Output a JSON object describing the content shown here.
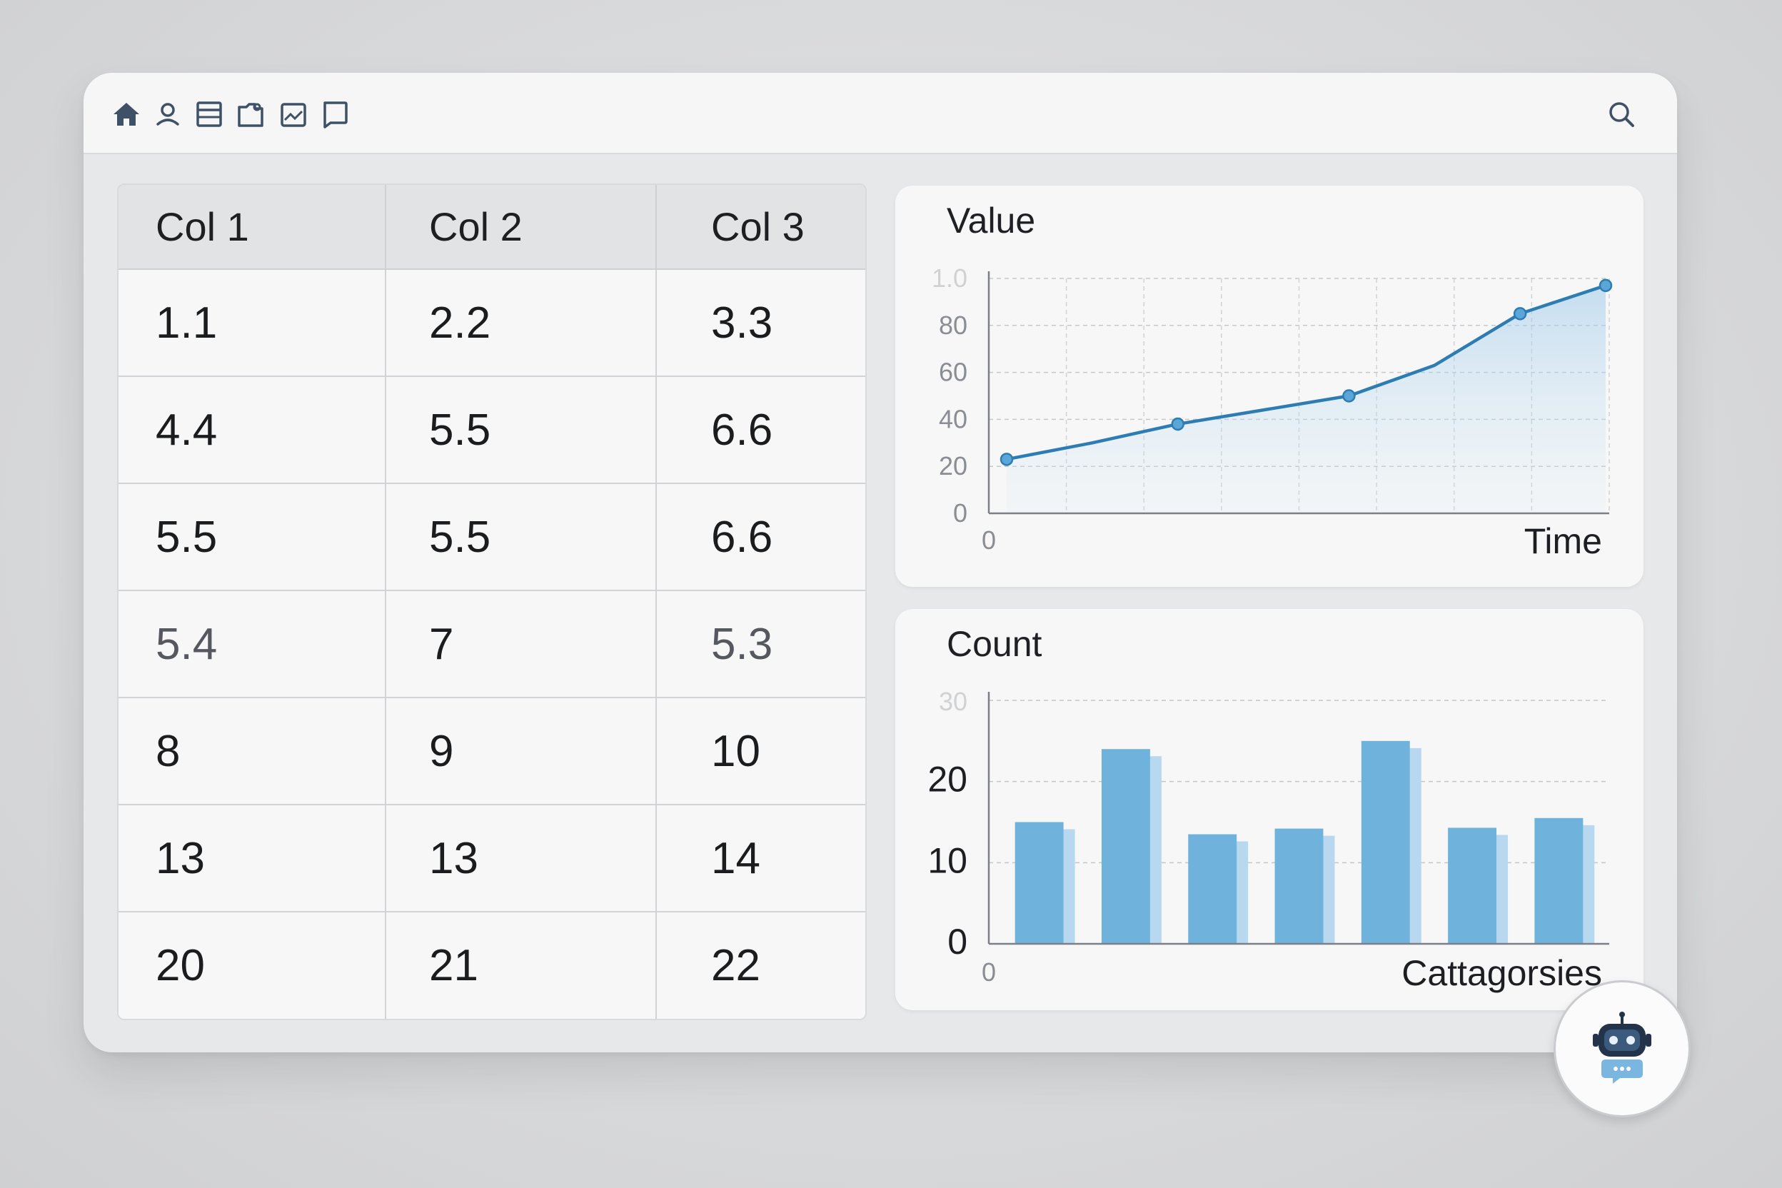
{
  "toolbar": {
    "icons": [
      "home-icon",
      "user-icon",
      "table-icon",
      "folder-icon",
      "image-icon",
      "chat-icon"
    ],
    "search_icon": "search-icon"
  },
  "table": {
    "headers": [
      "Col 1",
      "Col 2",
      "Col 3"
    ],
    "rows": [
      [
        "1.1",
        "2.2",
        "3.3"
      ],
      [
        "4.4",
        "5.5",
        "6.6"
      ],
      [
        "5.5",
        "5.5",
        "6.6"
      ],
      [
        "5.4",
        "7",
        "5.3"
      ],
      [
        "8",
        "9",
        "10"
      ],
      [
        "13",
        "13",
        "14"
      ],
      [
        "20",
        "21",
        "22"
      ]
    ]
  },
  "line_card": {
    "title": "Value",
    "xlabel": "Time",
    "x_origin_label": "0"
  },
  "bar_card": {
    "title": "Count",
    "xlabel": "Cattagorsies",
    "x_origin_label": "0"
  },
  "chart_data": [
    {
      "type": "line",
      "ylabel": "Value",
      "xlabel": "Time",
      "ylim": [
        0,
        100
      ],
      "yticks": [
        "0",
        "20",
        "40",
        "60",
        "80",
        "1.0"
      ],
      "grid": true,
      "x": [
        0,
        1,
        2,
        3,
        4,
        5,
        6,
        7
      ],
      "values": [
        23,
        30,
        38,
        44,
        50,
        63,
        85,
        97
      ],
      "markers": [
        0,
        2,
        4,
        6,
        7
      ],
      "color": "#2d7db3"
    },
    {
      "type": "bar",
      "ylabel": "Count",
      "xlabel": "Cattagorsies",
      "ylim": [
        0,
        30
      ],
      "yticks": [
        "0",
        "10",
        "20",
        "30"
      ],
      "grid": true,
      "values": [
        15,
        24,
        13.5,
        14.2,
        25,
        14.3,
        15.5
      ],
      "color": "#6fb2dc"
    }
  ],
  "assistant": {
    "icon": "robot-assistant-icon"
  },
  "colors": {
    "accent": "#3e87bf",
    "icon": "#3f5166"
  }
}
